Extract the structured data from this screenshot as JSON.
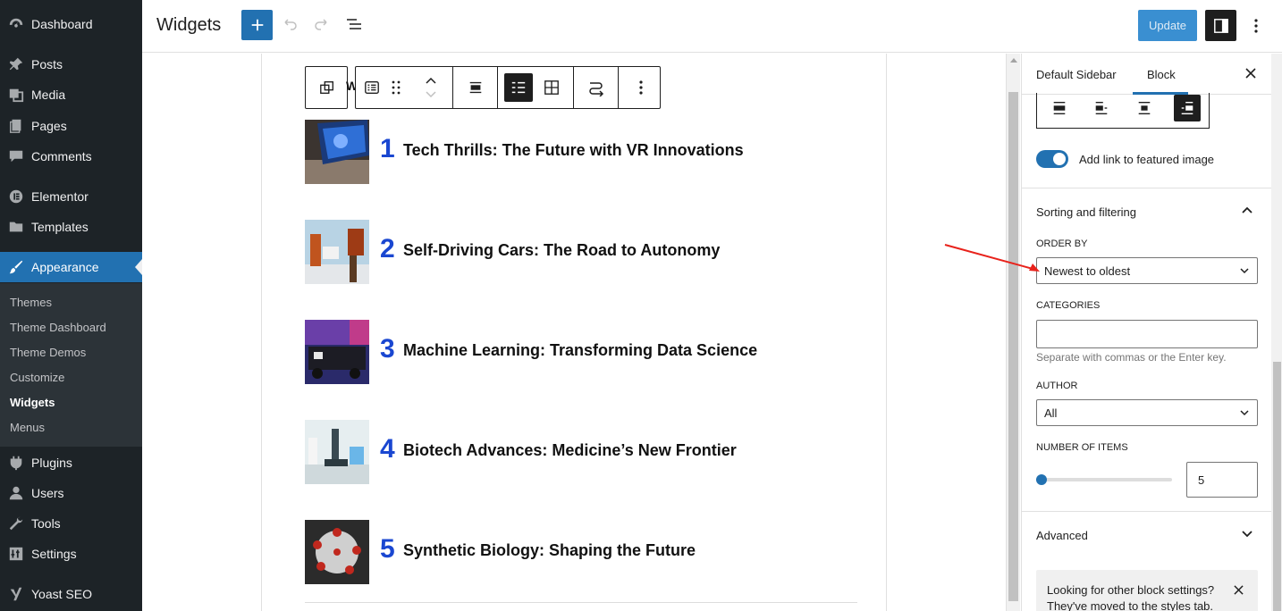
{
  "admin_menu": {
    "items": [
      {
        "label": "Dashboard",
        "icon": "dashboard-icon"
      },
      {
        "label": "Posts",
        "icon": "pin-icon"
      },
      {
        "label": "Media",
        "icon": "media-icon"
      },
      {
        "label": "Pages",
        "icon": "pages-icon"
      },
      {
        "label": "Comments",
        "icon": "comment-icon"
      },
      {
        "label": "Elementor",
        "icon": "elementor-icon"
      },
      {
        "label": "Templates",
        "icon": "folder-icon"
      },
      {
        "label": "Appearance",
        "icon": "brush-icon"
      },
      {
        "label": "Plugins",
        "icon": "plugin-icon"
      },
      {
        "label": "Users",
        "icon": "user-icon"
      },
      {
        "label": "Tools",
        "icon": "wrench-icon"
      },
      {
        "label": "Settings",
        "icon": "settings-icon"
      },
      {
        "label": "Yoast SEO",
        "icon": "yoast-icon"
      }
    ],
    "submenu": [
      "Themes",
      "Theme Dashboard",
      "Theme Demos",
      "Customize",
      "Widgets",
      "Menus"
    ],
    "current_submenu": "Widgets"
  },
  "header": {
    "title": "Widgets",
    "update_label": "Update"
  },
  "posts": [
    {
      "number": "1",
      "title": "Tech Thrills: The Future with VR Innovations"
    },
    {
      "number": "2",
      "title": "Self-Driving Cars: The Road to Autonomy"
    },
    {
      "number": "3",
      "title": "Machine Learning: Transforming Data Science"
    },
    {
      "number": "4",
      "title": "Biotech Advances: Medicine’s New Frontier"
    },
    {
      "number": "5",
      "title": "Synthetic Biology: Shaping the Future"
    }
  ],
  "toolbar_fragment": "W",
  "settings": {
    "tabs": [
      "Default Sidebar",
      "Block"
    ],
    "active_tab": "Block",
    "toggle_label": "Add link to featured image",
    "toggle_on": true,
    "sorting_title": "Sorting and filtering",
    "order_by_label": "ORDER BY",
    "order_by_value": "Newest to oldest",
    "categories_label": "CATEGORIES",
    "categories_value": "",
    "categories_help": "Separate with commas or the Enter key.",
    "author_label": "AUTHOR",
    "author_value": "All",
    "number_label": "NUMBER OF ITEMS",
    "number_value": "5",
    "advanced_title": "Advanced",
    "notice_text": "Looking for other block settings? They've moved to the styles tab."
  },
  "colors": {
    "accent": "#2271b1",
    "sidebar_bg": "#1d2327",
    "number_blue": "#1a47d1",
    "annotation_red": "#e8221b"
  }
}
